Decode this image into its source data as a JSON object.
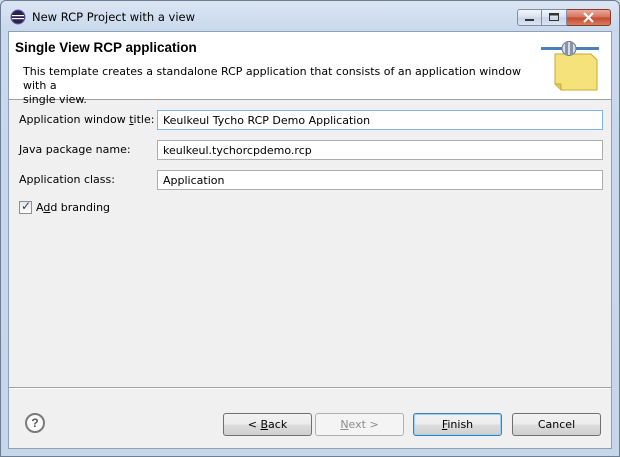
{
  "window": {
    "title": "New RCP Project with a view",
    "icon": "eclipse-icon"
  },
  "caption_buttons": {
    "minimize": "minimize-icon",
    "maximize": "maximize-icon",
    "close": "close-icon"
  },
  "header": {
    "title": "Single View RCP application",
    "description_line1": "This template creates a standalone RCP application that consists of an application window with a",
    "description_line2": "single view."
  },
  "form": {
    "app_title_label": "Application window title:",
    "app_title_value": "Keulkeul Tycho RCP Demo Application",
    "package_label": "Java package name:",
    "package_value": "keulkeul.tychorcpdemo.rcp",
    "class_label": "Application class:",
    "class_value": "Application",
    "branding_label": "Add branding",
    "branding_checked": true
  },
  "buttons": {
    "help": "?",
    "back": "< Back",
    "next": "Next >",
    "finish": "Finish",
    "cancel": "Cancel"
  },
  "colors": {
    "titlebar": "#c9d8ec",
    "close_button": "#c4482c",
    "default_button_border": "#3c7fb1"
  }
}
